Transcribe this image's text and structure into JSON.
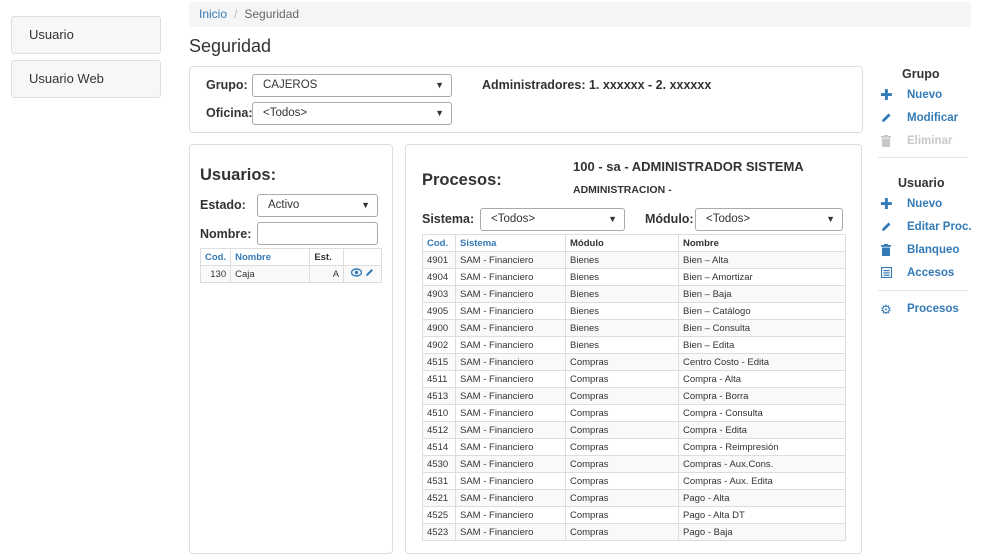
{
  "leftnav": {
    "items": [
      {
        "label": "Usuario"
      },
      {
        "label": "Usuario Web"
      }
    ]
  },
  "breadcrumb": {
    "home": "Inicio",
    "current": "Seguridad"
  },
  "page": {
    "title": "Seguridad"
  },
  "filters": {
    "grupo_label": "Grupo:",
    "grupo_value": "CAJEROS",
    "oficina_label": "Oficina:",
    "oficina_value": "<Todos>",
    "administradores": "Administradores: 1. xxxxxx - 2. xxxxxx"
  },
  "usuarios": {
    "title": "Usuarios:",
    "estado_label": "Estado:",
    "estado_value": "Activo",
    "nombre_label": "Nombre:",
    "columns": [
      "Cod.",
      "Nombre",
      "Est.",
      ""
    ],
    "rows": [
      {
        "cod": "130",
        "nombre": "Caja",
        "est": "A"
      }
    ]
  },
  "procesos": {
    "title": "Procesos:",
    "header_user": "100 - sa - ADMINISTRADOR SISTEMA",
    "header_area": "ADMINISTRACION -",
    "sistema_label": "Sistema:",
    "sistema_value": "<Todos>",
    "modulo_label": "Módulo:",
    "modulo_value": "<Todos>",
    "columns": [
      "Cod.",
      "Sistema",
      "Módulo",
      "Nombre"
    ],
    "rows": [
      [
        "4901",
        "SAM - Financiero",
        "Bienes",
        "Bien – Alta"
      ],
      [
        "4904",
        "SAM - Financiero",
        "Bienes",
        "Bien – Amortizar"
      ],
      [
        "4903",
        "SAM - Financiero",
        "Bienes",
        "Bien – Baja"
      ],
      [
        "4905",
        "SAM - Financiero",
        "Bienes",
        "Bien – Catálogo"
      ],
      [
        "4900",
        "SAM - Financiero",
        "Bienes",
        "Bien – Consulta"
      ],
      [
        "4902",
        "SAM - Financiero",
        "Bienes",
        "Bien – Edita"
      ],
      [
        "4515",
        "SAM - Financiero",
        "Compras",
        "Centro Costo - Edita"
      ],
      [
        "4511",
        "SAM - Financiero",
        "Compras",
        "Compra - Alta"
      ],
      [
        "4513",
        "SAM - Financiero",
        "Compras",
        "Compra - Borra"
      ],
      [
        "4510",
        "SAM - Financiero",
        "Compras",
        "Compra - Consulta"
      ],
      [
        "4512",
        "SAM - Financiero",
        "Compras",
        "Compra - Edita"
      ],
      [
        "4514",
        "SAM - Financiero",
        "Compras",
        "Compra - Reimpresión"
      ],
      [
        "4530",
        "SAM - Financiero",
        "Compras",
        "Compras - Aux.Cons."
      ],
      [
        "4531",
        "SAM - Financiero",
        "Compras",
        "Compras - Aux. Edita"
      ],
      [
        "4521",
        "SAM - Financiero",
        "Compras",
        "Pago - Alta"
      ],
      [
        "4525",
        "SAM - Financiero",
        "Compras",
        "Pago - Alta DT"
      ],
      [
        "4523",
        "SAM - Financiero",
        "Compras",
        "Pago - Baja"
      ]
    ]
  },
  "side": {
    "grupo_title": "Grupo",
    "grupo_actions": [
      "Nuevo",
      "Modificar",
      "Eliminar"
    ],
    "usuario_title": "Usuario",
    "usuario_actions": [
      "Nuevo",
      "Editar Proc.",
      "Blanqueo",
      "Accesos"
    ],
    "procesos_label": "Procesos"
  }
}
